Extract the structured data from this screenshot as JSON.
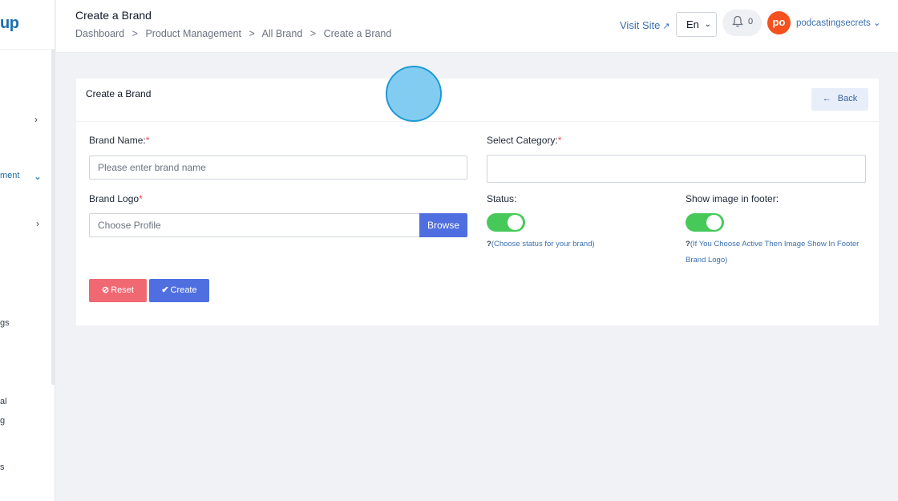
{
  "colors": {
    "primary": "#4f6fe0",
    "danger": "#f06872",
    "toggle_on": "#47c95a",
    "link": "#3a6fb0",
    "avatar_bg": "#f4511e"
  },
  "sidebar": {
    "logo_fragment": "up",
    "items": [
      {
        "label": "",
        "chevron": "›"
      },
      {
        "label": "ment",
        "chevron": "⌄"
      },
      {
        "label": "",
        "chevron": "›"
      },
      {
        "label": "gs"
      },
      {
        "label": "al"
      },
      {
        "label": "g"
      },
      {
        "label": "s"
      }
    ]
  },
  "header": {
    "title": "Create a Brand",
    "breadcrumb": [
      "Dashboard",
      "Product Management",
      "All Brand",
      "Create a Brand"
    ],
    "breadcrumb_sep": ">",
    "visit_site": "Visit Site",
    "language": "En",
    "notification_count": "0",
    "avatar_initials": "po",
    "username": "podcastingsecrets",
    "icons": {
      "external_link": "external-link-icon",
      "bell": "bell-icon",
      "chevron_down": "chevron-down-icon"
    }
  },
  "card": {
    "title": "Create a Brand",
    "back_label": "Back",
    "brand_name": {
      "label": "Brand Name:",
      "required": "*",
      "placeholder": "Please enter brand name"
    },
    "select_category": {
      "label": "Select Category:",
      "required": "*",
      "value": ""
    },
    "brand_logo": {
      "label": "Brand Logo",
      "required": "*",
      "placeholder": "Choose Profile",
      "browse_label": "Browse"
    },
    "status": {
      "label": "Status:",
      "enabled": true,
      "hint": "(Choose status for your brand)"
    },
    "footer_image": {
      "label": "Show image in footer:",
      "enabled": true,
      "hint_line1": "(If You Choose Active Then Image Show In Footer",
      "hint_line2": "Brand Logo)"
    },
    "reset_label": "Reset",
    "create_label": "Create"
  }
}
